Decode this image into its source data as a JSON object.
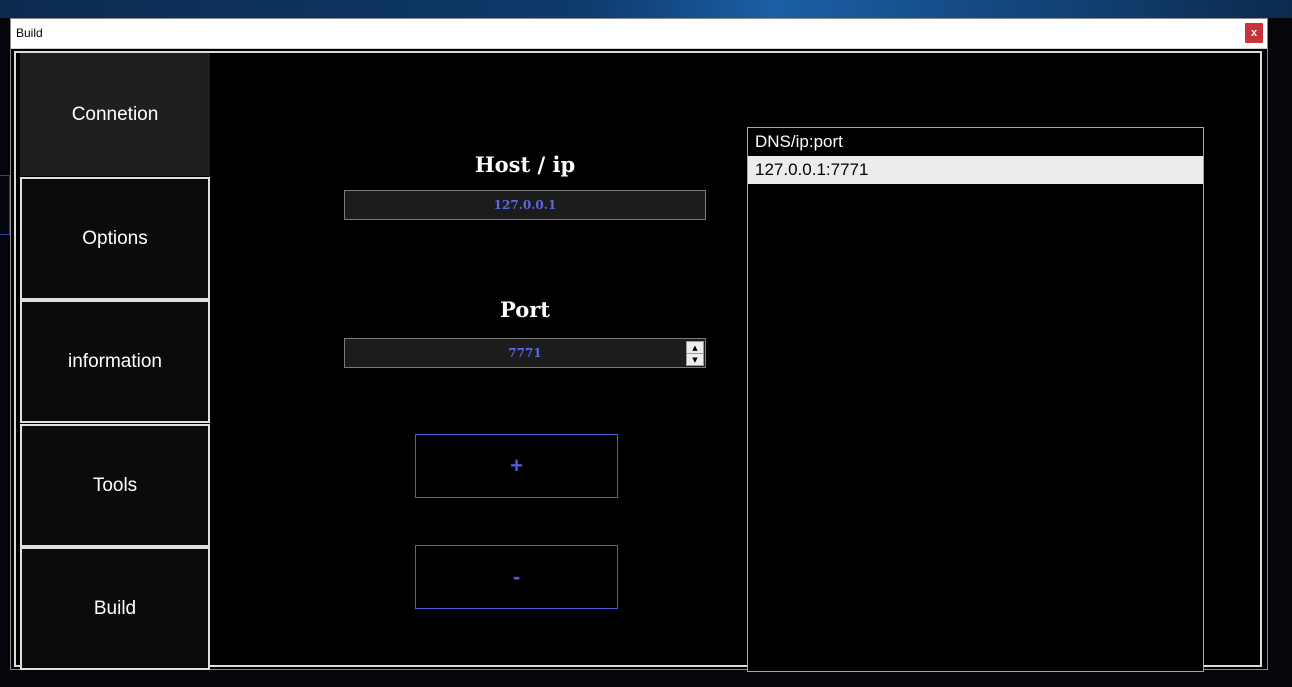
{
  "window": {
    "title": "Build",
    "close_label": "x"
  },
  "sidebar": {
    "items": [
      {
        "label": "Connetion",
        "active": true
      },
      {
        "label": "Options",
        "active": false
      },
      {
        "label": "information",
        "active": false
      },
      {
        "label": "Tools",
        "active": false
      },
      {
        "label": "Build",
        "active": false
      }
    ]
  },
  "connection": {
    "host_label": "Host / ip",
    "host_value": "127.0.0.1",
    "port_label": "Port",
    "port_value": "7771",
    "add_label": "+",
    "remove_label": "-"
  },
  "list": {
    "header": "DNS/ip:port",
    "rows": [
      "127.0.0.1:7771"
    ]
  },
  "colors": {
    "accent": "#4d5ad6",
    "close": "#c8323a",
    "background": "#000000"
  }
}
